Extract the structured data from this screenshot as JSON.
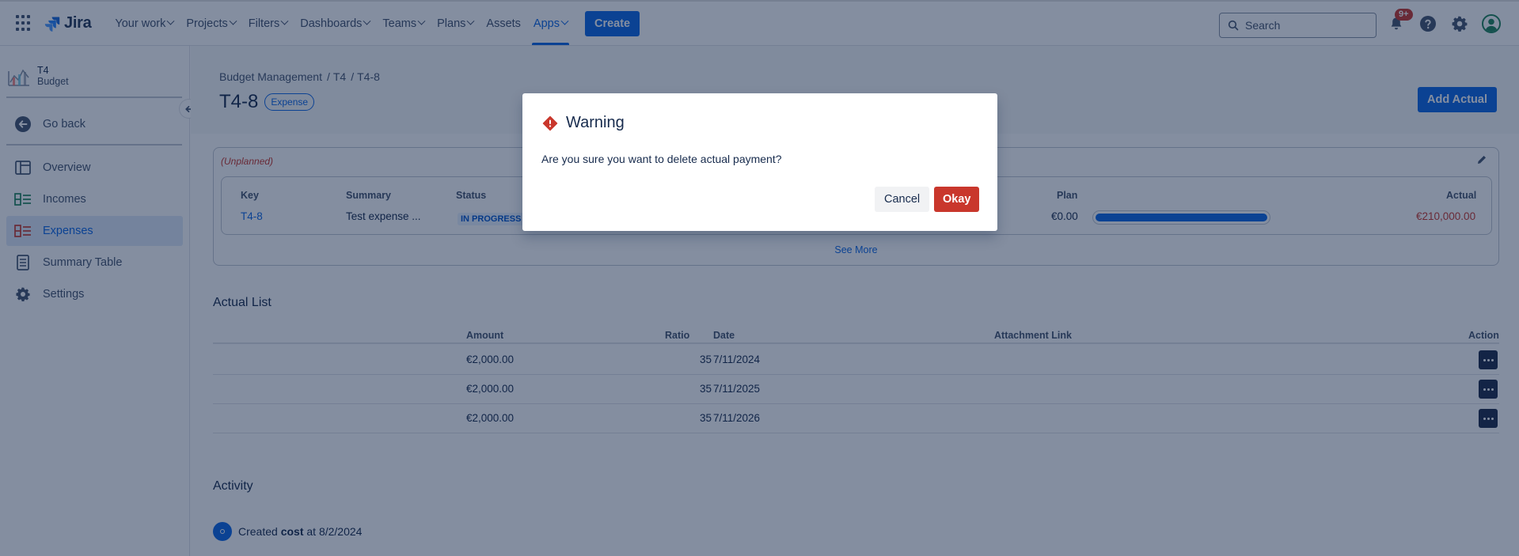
{
  "topnav": {
    "logo_name": "Jira",
    "items": [
      {
        "label": "Your work",
        "has_menu": true
      },
      {
        "label": "Projects",
        "has_menu": true
      },
      {
        "label": "Filters",
        "has_menu": true
      },
      {
        "label": "Dashboards",
        "has_menu": true
      },
      {
        "label": "Teams",
        "has_menu": true
      },
      {
        "label": "Plans",
        "has_menu": true
      },
      {
        "label": "Assets",
        "has_menu": false
      },
      {
        "label": "Apps",
        "has_menu": true,
        "active": true
      }
    ],
    "create_label": "Create",
    "search_placeholder": "Search",
    "notification_badge": "9+",
    "icons": [
      "notifications-icon",
      "help-icon",
      "settings-icon",
      "profile-icon"
    ]
  },
  "sidebar": {
    "project_name": "T4",
    "project_sub": "Budget",
    "go_back": "Go back",
    "items": [
      {
        "label": "Overview",
        "icon": "overview-icon"
      },
      {
        "label": "Incomes",
        "icon": "incomes-icon"
      },
      {
        "label": "Expenses",
        "icon": "expenses-icon",
        "selected": true
      },
      {
        "label": "Summary Table",
        "icon": "summary-table-icon"
      },
      {
        "label": "Settings",
        "icon": "settings-icon"
      }
    ]
  },
  "main": {
    "breadcrumbs": [
      "Budget Management",
      "T4",
      "T4-8"
    ],
    "issue_key": "T4-8",
    "issue_type": "Expense",
    "add_actual_label": "Add Actual",
    "card": {
      "tag": "(Unplanned)",
      "headers": {
        "key": "Key",
        "summary": "Summary",
        "status": "Status",
        "plan": "Plan",
        "actual": "Actual"
      },
      "row": {
        "key": "T4-8",
        "summary": "Test expense ...",
        "status": "IN PROGRESS",
        "plan": "€0.00",
        "actual": "€210,000.00",
        "progress": 1.0
      },
      "see_more": "See More"
    },
    "actual_list": {
      "title": "Actual List",
      "columns": {
        "amount": "Amount",
        "ratio": "Ratio",
        "date": "Date",
        "attachment": "Attachment Link",
        "action": "Action"
      },
      "rows": [
        {
          "amount": "€2,000.00",
          "ratio": "35",
          "date": "7/11/2024",
          "attachment": ""
        },
        {
          "amount": "€2,000.00",
          "ratio": "35",
          "date": "7/11/2025",
          "attachment": ""
        },
        {
          "amount": "€2,000.00",
          "ratio": "35",
          "date": "7/11/2026",
          "attachment": ""
        }
      ]
    },
    "activity": {
      "title": "Activity",
      "entry_prefix": "Created",
      "entry_field": "cost",
      "entry_suffix": "at 8/2/2024"
    }
  },
  "modal": {
    "title": "Warning",
    "message": "Are you sure you want to delete actual payment?",
    "cancel_label": "Cancel",
    "okay_label": "Okay"
  },
  "colors": {
    "brand": "#0c66e4",
    "danger": "#c9372c",
    "overlay": "rgba(9, 30, 66, 0.50)"
  }
}
